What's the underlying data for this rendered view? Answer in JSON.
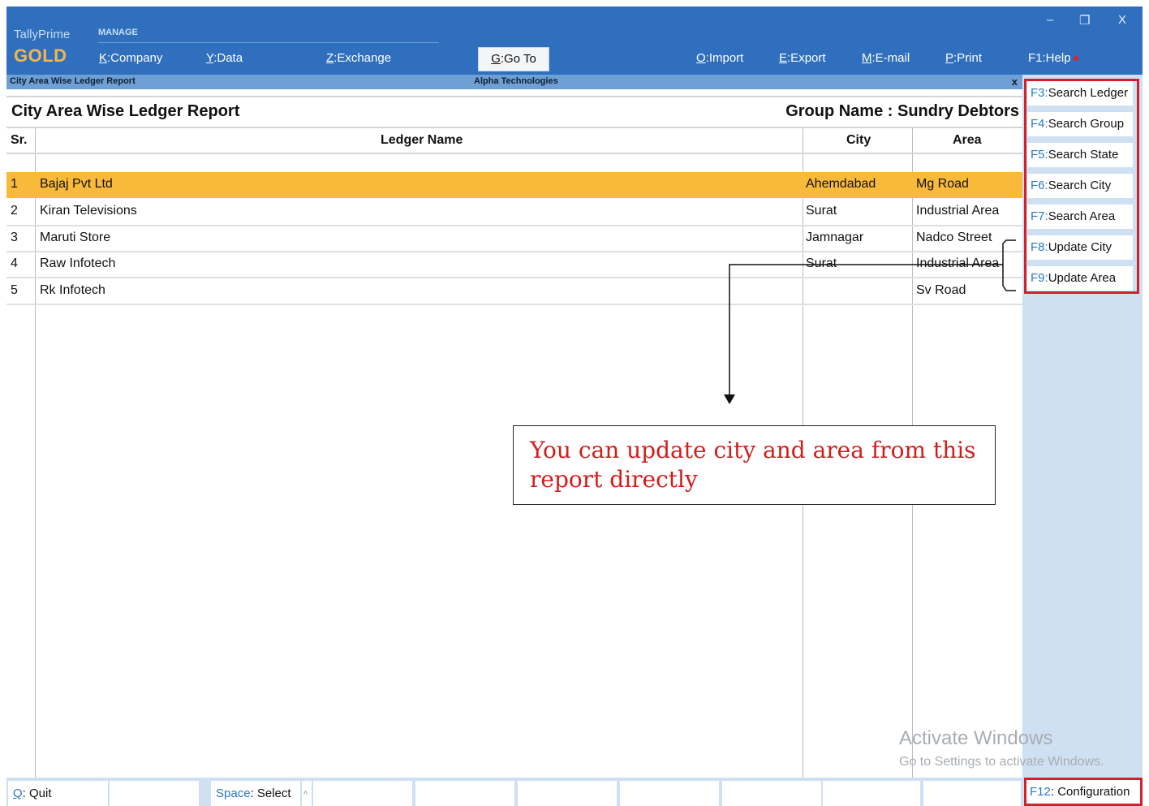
{
  "app": {
    "name": "TallyPrime",
    "edition": "GOLD",
    "section_label": "MANAGE"
  },
  "top_menu": [
    {
      "key": "K",
      "label": ":Company"
    },
    {
      "key": "Y",
      "label": ":Data"
    },
    {
      "key": "Z",
      "label": ":Exchange"
    },
    {
      "key": "G",
      "label": ":Go To"
    },
    {
      "key": "O",
      "label": ":Import"
    },
    {
      "key": "E",
      "label": ":Export"
    },
    {
      "key": "M",
      "label": ":E-mail"
    },
    {
      "key": "P",
      "label": ":Print"
    },
    {
      "key": "F1",
      "label": ":Help"
    }
  ],
  "window_controls": {
    "minimize": "–",
    "restore": "❐",
    "close": "X"
  },
  "subbar": {
    "report_name": "City Area Wise Ledger Report",
    "company": "Alpha Technologies",
    "close": "x"
  },
  "report": {
    "title": "City Area Wise Ledger Report",
    "group_name": "Group Name : Sundry Debtors",
    "columns": [
      "Sr.",
      "Ledger Name",
      "City",
      "Area"
    ],
    "rows": [
      {
        "sr": "1",
        "ledger": "Bajaj Pvt Ltd",
        "city": "Ahemdabad",
        "area": "Mg Road",
        "selected": true
      },
      {
        "sr": "2",
        "ledger": "Kiran Televisions",
        "city": "Surat",
        "area": "Industrial Area",
        "selected": false
      },
      {
        "sr": "3",
        "ledger": "Maruti Store",
        "city": "Jamnagar",
        "area": "Nadco Street",
        "selected": false
      },
      {
        "sr": "4",
        "ledger": "Raw Infotech",
        "city": "Surat",
        "area": "Industrial Area",
        "selected": false
      },
      {
        "sr": "5",
        "ledger": "Rk Infotech",
        "city": "",
        "area": "Sv Road",
        "selected": false
      }
    ]
  },
  "right_panel": [
    {
      "key": "F3",
      "label": "Search Ledger"
    },
    {
      "key": "F4",
      "label": "Search Group"
    },
    {
      "key": "F5",
      "label": "Search State"
    },
    {
      "key": "F6",
      "label": "Search City"
    },
    {
      "key": "F7",
      "label": "Search Area"
    },
    {
      "key": "F8",
      "label": "Update City"
    },
    {
      "key": "F9",
      "label": "Update Area"
    }
  ],
  "bottom_bar": {
    "quit_key": "Q",
    "quit_label": ": Quit",
    "select_key": "Space",
    "select_label": ": Select",
    "caret": "^",
    "config_key": "F12",
    "config_label": ": Configuration"
  },
  "callout": "You can update city and area from this report directly",
  "watermark": {
    "line1": "Activate Windows",
    "line2": "Go to Settings to activate Windows."
  },
  "colors": {
    "top_bar": "#2f6fbe",
    "selected_row": "#f9b93b",
    "highlight_box": "#d3212b",
    "callout_text": "#d31c1c"
  }
}
